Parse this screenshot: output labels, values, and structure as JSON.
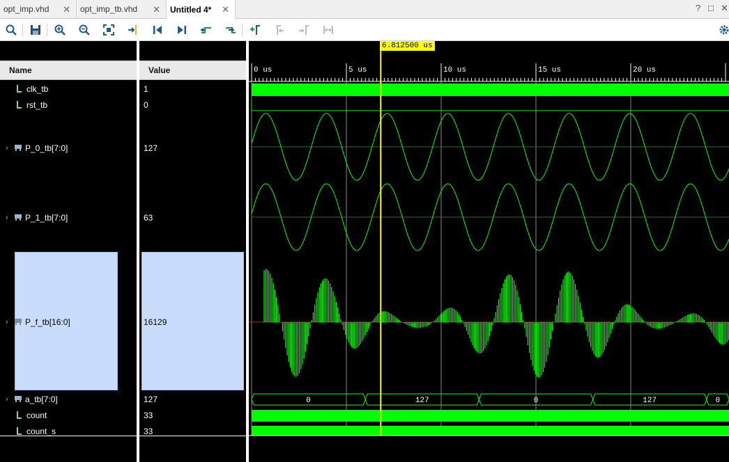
{
  "tabs": [
    {
      "label": "opt_imp.vhd",
      "active": false
    },
    {
      "label": "opt_imp_tb.vhd",
      "active": false
    },
    {
      "label": "Untitled 4*",
      "active": true
    }
  ],
  "window_controls": {
    "help": "?",
    "restore": "□",
    "close": "✕"
  },
  "toolbar_icons": [
    "search-icon",
    "save-icon",
    "zoom-in-icon",
    "zoom-out-icon",
    "zoom-fit-icon",
    "go-to-cursor-icon",
    "go-to-time-0-icon",
    "go-to-last-time-icon",
    "previous-transition-icon",
    "next-transition-icon",
    "add-marker-icon",
    "previous-marker-icon",
    "next-marker-icon",
    "swap-cursors-icon",
    "settings-gear-icon"
  ],
  "columns": {
    "name": "Name",
    "value": "Value"
  },
  "cursor": {
    "time_label": "6.812500 us",
    "time_us": 6.8125
  },
  "timeline": {
    "ticks": [
      {
        "label": "0 us",
        "us": 0
      },
      {
        "label": "5 us",
        "us": 5
      },
      {
        "label": "10 us",
        "us": 10
      },
      {
        "label": "15 us",
        "us": 15
      },
      {
        "label": "20 us",
        "us": 20
      }
    ]
  },
  "signals": [
    {
      "name": "clk_tb",
      "value": "1",
      "kind": "bit",
      "expandable": false
    },
    {
      "name": "rst_tb",
      "value": "0",
      "kind": "bit",
      "expandable": false
    },
    {
      "name": "P_0_tb[7:0]",
      "value": "127",
      "kind": "analog",
      "expandable": true
    },
    {
      "name": "P_1_tb[7:0]",
      "value": "63",
      "kind": "analog",
      "expandable": true
    },
    {
      "name": "P_f_tb[16:0]",
      "value": "16129",
      "kind": "analog",
      "expandable": true,
      "selected": true
    },
    {
      "name": "a_tb[7:0]",
      "value": "127",
      "kind": "bus",
      "expandable": true
    },
    {
      "name": "count",
      "value": "33",
      "kind": "bit",
      "expandable": false
    },
    {
      "name": "count_s",
      "value": "33",
      "kind": "bit",
      "expandable": false
    }
  ],
  "bus_a_tb": [
    "0",
    "127",
    "0",
    "127",
    "0"
  ],
  "colors": {
    "wave": "#00ff00",
    "cursor": "#ffff00",
    "selection": "#c9dcfb"
  }
}
